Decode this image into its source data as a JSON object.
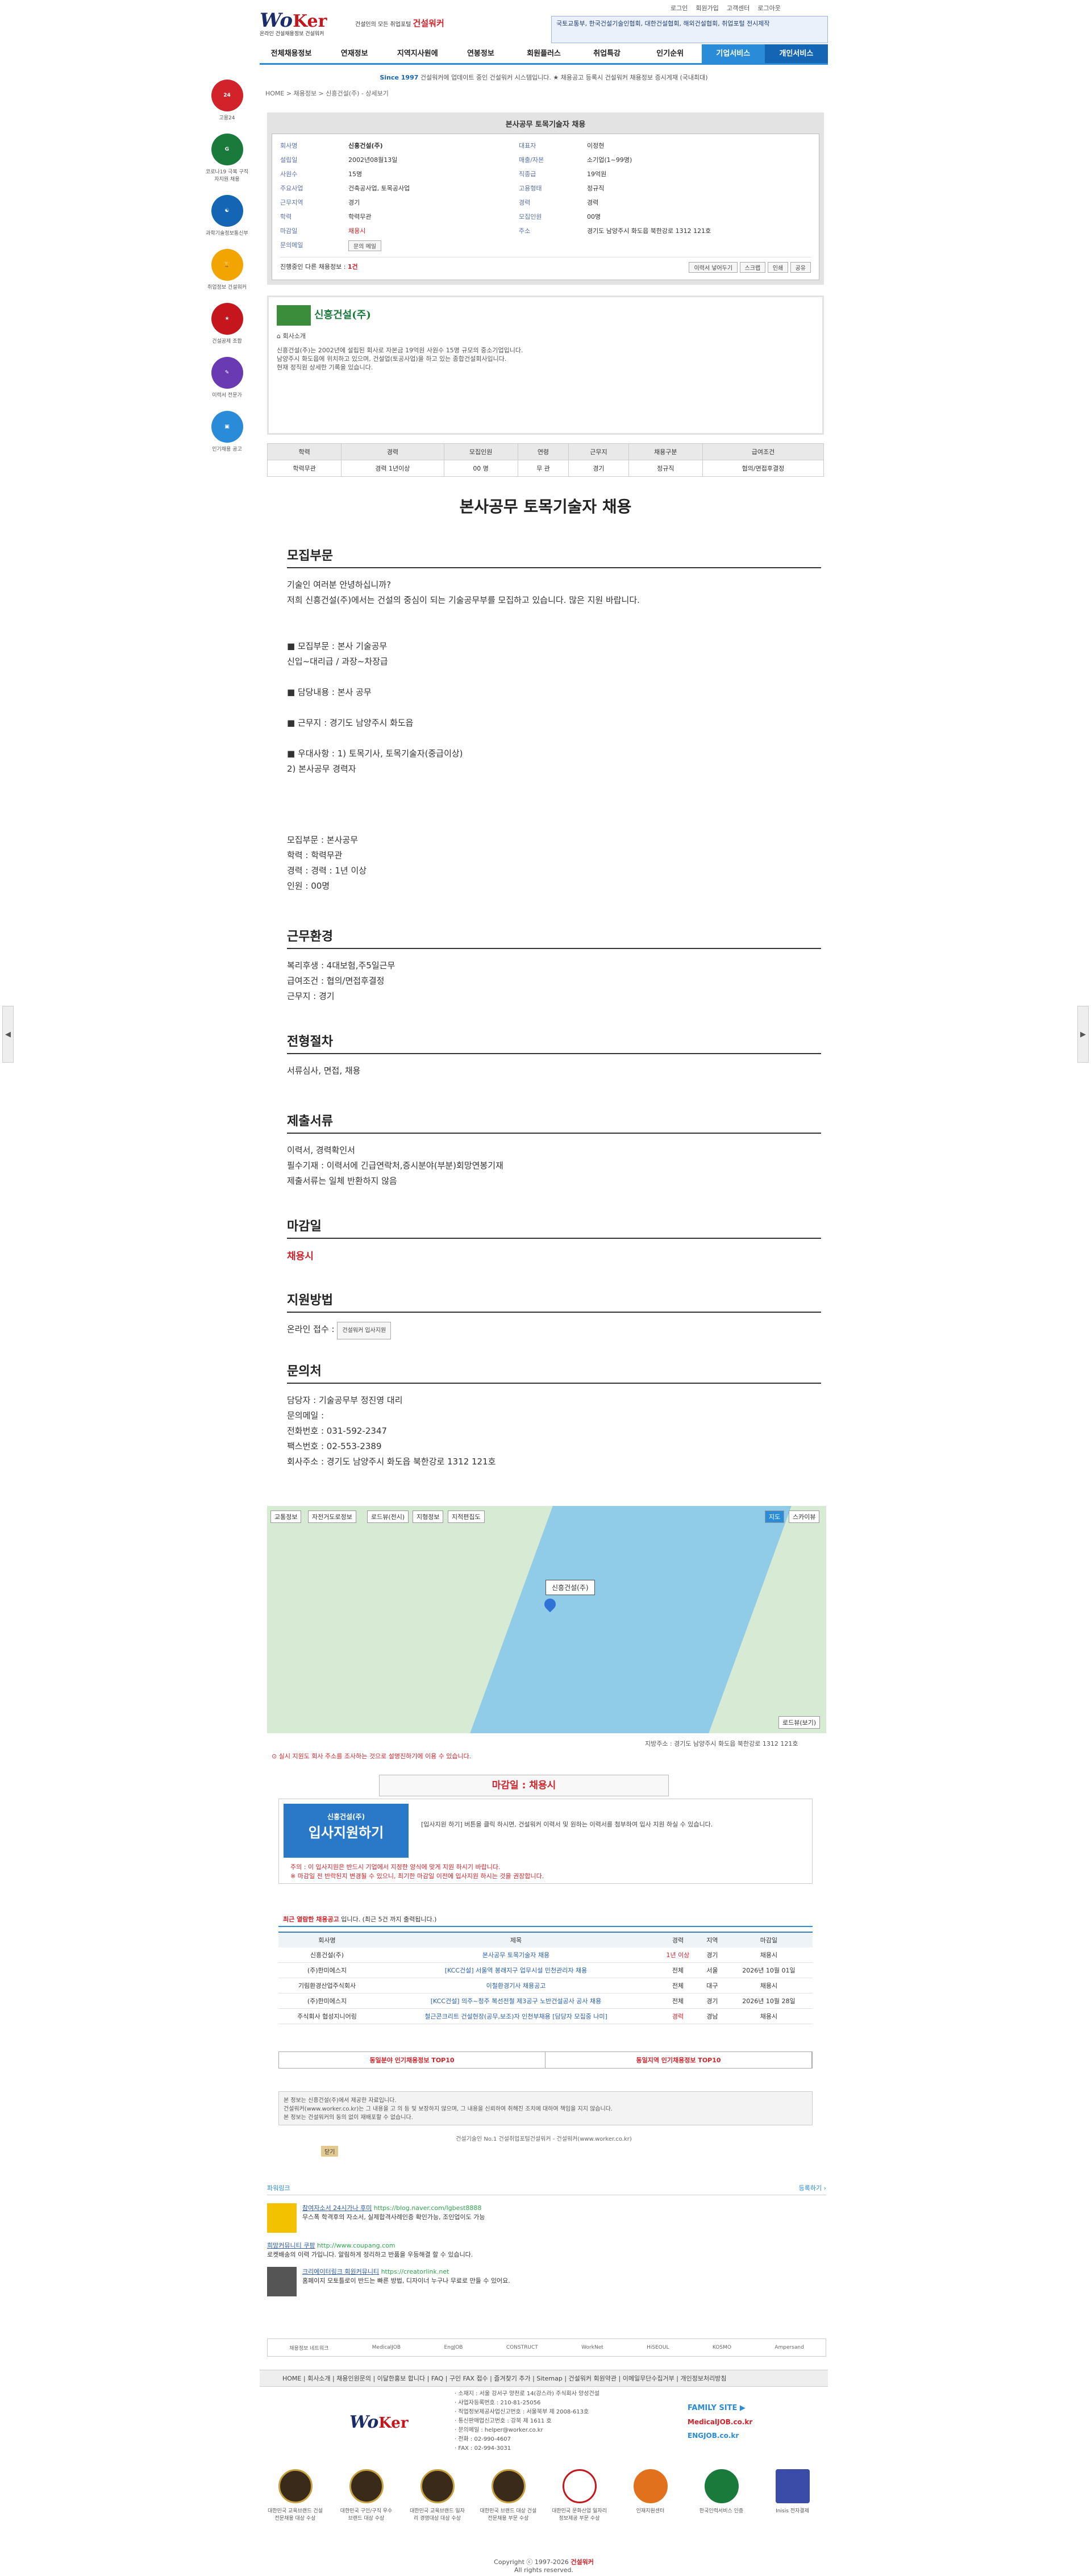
{
  "header": {
    "util": [
      "로그인",
      "회원가입",
      "고객센터",
      "로그아웃"
    ],
    "logo_main": "Wo",
    "logo_accent": "Ker",
    "logo_sub": "온라인 건설채용정보 건설워커",
    "slogan": "건설인의 모든 취업포털",
    "slogan_brand": "건설워커",
    "banner": "국토교통부, 한국건설기술인협회, 대한건설협회, 해외건설협회, 취업포털 전시제작",
    "nav": [
      "전체채용정보",
      "연재정보",
      "지역지사원에",
      "연봉정보",
      "회원플러스",
      "취업특강",
      "인기순위",
      "기업서비스",
      "개인서비스"
    ]
  },
  "notice": {
    "prefix": "Since 1997",
    "text": "건설워커에 업데이트 중인 건설워커 시스템입니다. ★ 채용공고 등록시 건설워커 채용정보 증시게재 (국내최대)"
  },
  "breadcrumb": "HOME > 채용정보 > 신흥건설(주) - 상세보기",
  "left_ads": [
    {
      "label": "고용24",
      "color": "#d2232a"
    },
    {
      "label": "코로나19 극복 구직자지원 채용",
      "color": "#1a7a3c"
    },
    {
      "label": "과학기술정보통신부",
      "color": "#1465b4"
    },
    {
      "label": "취업정보 건설워커",
      "color": "#f2a400"
    },
    {
      "label": "건설공제 조합",
      "color": "#c4161c"
    },
    {
      "label": "이력서 전문가",
      "color": "#6a3ab2"
    },
    {
      "label": "인기채용 공고",
      "color": "#2a8bd8"
    }
  ],
  "summary": {
    "heading": "본사공무 토목기술자 채용",
    "rows": [
      {
        "k1": "회사명",
        "v1": "신흥건설(주)",
        "k2": "대표자",
        "v2": "이정현"
      },
      {
        "k1": "설립일",
        "v1": "2002년08월13일",
        "k2": "매출/자본",
        "v2": "소기업(1~99명)"
      },
      {
        "k1": "사원수",
        "v1": "15명",
        "k2": "직종급",
        "v2": "19억원"
      },
      {
        "k1": "주요사업",
        "v1": "건축공사업, 토목공사업",
        "k2": "고용형태",
        "v2": "정규직"
      },
      {
        "k1": "근무지역",
        "v1": "경기",
        "k2": "경력",
        "v2": "경력"
      },
      {
        "k1": "학력",
        "v1": "학력무관",
        "k2": "모집인원",
        "v2": "00명"
      },
      {
        "k1": "마감일",
        "v1": "채용시",
        "k2": "주소",
        "v2": "경기도 남양주시 화도읍 북한강로 1312 121호"
      },
      {
        "k1": "문의메일",
        "v1": "문의 메일",
        "k2": "",
        "v2": ""
      }
    ],
    "foot_left": "진행중인 다른 채용정보 :",
    "foot_count": "1건",
    "share": [
      "이력서 넣어두기",
      "스크랩",
      "인쇄",
      "공유"
    ]
  },
  "company": {
    "name": "신흥건설(주)",
    "tab": "회사소개",
    "desc": "신흥건설(주)는 2002년에 설립된 회사로 자본금 19억원 사원수 15명 규모의 중소기업입니다.\n남양주시 화도읍에 위치하고 있으며, 건설업(토공사업)을 하고 있는 종합건설회사입니다.\n현재 정직원 상세한 기록을 있습니다."
  },
  "conditions": {
    "headers": [
      "학력",
      "경력",
      "모집인원",
      "연령",
      "근무지",
      "채용구분",
      "급여조건"
    ],
    "values": [
      "학력무관",
      "경력 1년이상",
      "00 명",
      "무 관",
      "경기",
      "정규직",
      "협의/면접후결정"
    ]
  },
  "title": "본사공무 토목기술자 채용",
  "sections": {
    "recruit_h": "모집부문",
    "recruit_txt": "기술인 여러분 안녕하십니까?\n저희 신흥건설(주)에서는 건설의 중심이 되는 기술공무부를 모집하고 있습니다. 많은 지원 바랍니다.\n\n\n■ 모집부문 : 본사 기술공무\n        신입~대리급 / 과장~차장급\n\n■ 담당내용 : 본사 공무\n\n■ 근무지 : 경기도 남양주시 화도읍\n\n■ 우대사항 : 1) 토목기사, 토목기술자(중급이상)\n        2) 본사공무 경력자",
    "recruit_sum": "모집부문 : 본사공무\n학력 : 학력무관\n경력 : 경력 : 1년 이상\n인원 : 00명",
    "env_h": "근무환경",
    "env_txt": "복리후생 : 4대보험,주5일근무\n급여조건 : 협의/면접후결정\n근무지 : 경기",
    "proc_h": "전형절차",
    "proc_txt": "서류심사, 면접, 채용",
    "docs_h": "제출서류",
    "docs_txt": "이력서, 경력확인서\n필수기재 : 이력서에 긴급연락처,증시분야(부분)회망연봉기재\n제출서류는 일체 반환하지 않음",
    "deadline_h": "마감일",
    "deadline_txt": "채용시",
    "method_h": "지원방법",
    "method_txt": "온라인 접수 :",
    "method_btn": "건설워커 입사지원",
    "contact_h": "문의처",
    "contact_txt": "담당자 : 기술공무부 정진영 대리\n문의메일 :\n전화번호 : 031-592-2347\n팩스번호 : 02-553-2389\n회사주소 : 경기도 남양주시 화도읍 북한강로 1312 121호"
  },
  "map": {
    "tabs": [
      "교통정보",
      "자전거도로정보",
      "로드뷰(전시)",
      "지형정보",
      "지적편집도"
    ],
    "type_btn": [
      "지도",
      "스카이뷰"
    ],
    "pin": "신흥건설(주)",
    "road": "로드뷰(보기)",
    "addr": "지방주소 : 경기도 남양주시 화도읍 북한강로 1312 121호"
  },
  "warn": "실시 지원도 회사 주소를 조사하는 것으로 설명진하기에 이용 수 있습니다.",
  "deadline_box": "마감일 : 채용시",
  "apply": {
    "btn": "입사지원하기",
    "btn_sub": "신흥건설(주)",
    "text": "[입사지원 하기] 버튼을 클릭 하시면, 건설워커 이력서 및 원하는 이력서를 첨부하여 입사 지원 하실 수 있습니다.",
    "note": "주의 : 이 입사지원은 반드시 기업에서 지정한 양식에 맞게 지원 하시기 바랍니다.\n※ 마감일 전 반락된지 변경될 수 있으니, 최기한 마감일 이전에 입사지원 하시는 것을 권장합니다."
  },
  "recent": {
    "head": "최근 열람한 채용공고",
    "head_sub": "입니다. (최근 5건 까지 출력됩니다.)",
    "cols": [
      "회사명",
      "제목",
      "경력",
      "지역",
      "마감일"
    ],
    "rows": [
      [
        "신흥건설(주)",
        "본사공무 토목기술자 채용",
        "1년 이상",
        "경기",
        "채용시"
      ],
      [
        "(주)한미에스지",
        "[KCC건설] 서울역 봉래지구 업무시설 민천관리자 채용",
        "전체",
        "서울",
        "2026년 10월 01일"
      ],
      [
        "기림환경산업주식회사",
        "이철환경기사 채용공고",
        "전체",
        "대구",
        "채용시"
      ],
      [
        "(주)한미에스지",
        "[KCC건설] 의주~청주 복선전철 제3공구 노반건설공사 공사 채용",
        "전체",
        "경기",
        "2026년 10월 28일"
      ],
      [
        "주식회사 협성지니어링",
        "철근콘크리트 건설현장(공무,보조)자 인천부채용 [담당자 모집중 나미]",
        "경력",
        "경남",
        "채용시"
      ]
    ]
  },
  "top10": {
    "a": "동일분야 인기채용정보 TOP10",
    "b": "동일지역 인기채용정보 TOP10"
  },
  "caution": "본 정보는 신흥건설(주)에서 제공한 자료입니다.\n건설워커(www.worker.co.kr)는 그 내용을 고 의 등 및 보장하지 않으며, 그 내용을 신뢰하여 취해진 조치에 대하여 책임을 지지 않습니다.\n본 정보는 건설워커의 동의 없이 재배포할 수 없습니다.",
  "caution_btn": "닫기",
  "copyright_line": "건설기술인 No.1 건설취업포털건설워커 - 건설워커(www.worker.co.kr)",
  "powerlink": {
    "head": "파워링크",
    "more": "등록하기 ›",
    "items": [
      {
        "t": "참여자소서 24시가나 후미",
        "u": "https://blog.naver.com/lgbest8888",
        "d": "무스폭 학격후의 자소서, 실제합격사례인증 확인가능, 조인업이도 가능"
      },
      {
        "t": "희망커뮤니티 쿠팡",
        "u": "http://www.coupang.com",
        "d": "로켓배송의 이력 가입니다. 알림하게 정리하고 반품을 우등해결 할 수 있습니다."
      },
      {
        "t": "크리에이터링크 회원커뮤니티",
        "u": "https://creatorlink.net",
        "d": "홈페이지 모토틀로이 반드는 빠른 방법, 디자이너 누구나 무료로 만들 수 있어요."
      }
    ]
  },
  "partners": [
    "채용정보 네트워크",
    "MedicalJOB",
    "EngJOB",
    "CONSTRUCT",
    "WorkNet",
    "HiSEOUL",
    "KOSMO",
    "Ampersand"
  ],
  "foot_nav": "HOME | 회사소개 | 채용인원문의 | 이달한홍보 합니다 | FAQ | 구인 FAX 접수 | 즐겨찾기 추가 | Sitemap | 건설워커 회원약관 | 이메일무단수집거부 | 개인정보처리방침",
  "foot_info": "· 소재지 : 서울 강서구 양천로 14(강스라) 주식회사 양성건설\n· 사업자등록번호 : 210-81-25056\n· 직업정보제공사업신고번호 : 서울북부 제 2008-613호\n· 통신판매업신고번호 : 강북 제 1611 호\n· 문의메일 : helper@worker.co.kr\n· 전화 : 02-990-4607\n· FAX : 02-994-3031",
  "family_site": "FAMILY SITE ▶",
  "family_links": [
    "MedicalJOB.co.kr",
    "ENGJOB.co.kr"
  ],
  "certs": [
    "대한민국 교육브랜드 건설전문채용 대상 수상",
    "대한민국 구인/구직 우수 브랜드 대상 수상",
    "대한민국 교육브랜드 일자리 경영대상 대상 수상",
    "대한민국 브랜드 대상 건설전문채용 부문 수상",
    "대한민국 문화산업 일자리정보제공 부문 수상",
    "인재지원센터",
    "한국인력서비스 인증",
    "Inisis 전자결제"
  ],
  "copyright": "Copyright ⓒ 1997-2026",
  "copyright_brand": "건설워커",
  "copyright_tail": "All rights reserved."
}
